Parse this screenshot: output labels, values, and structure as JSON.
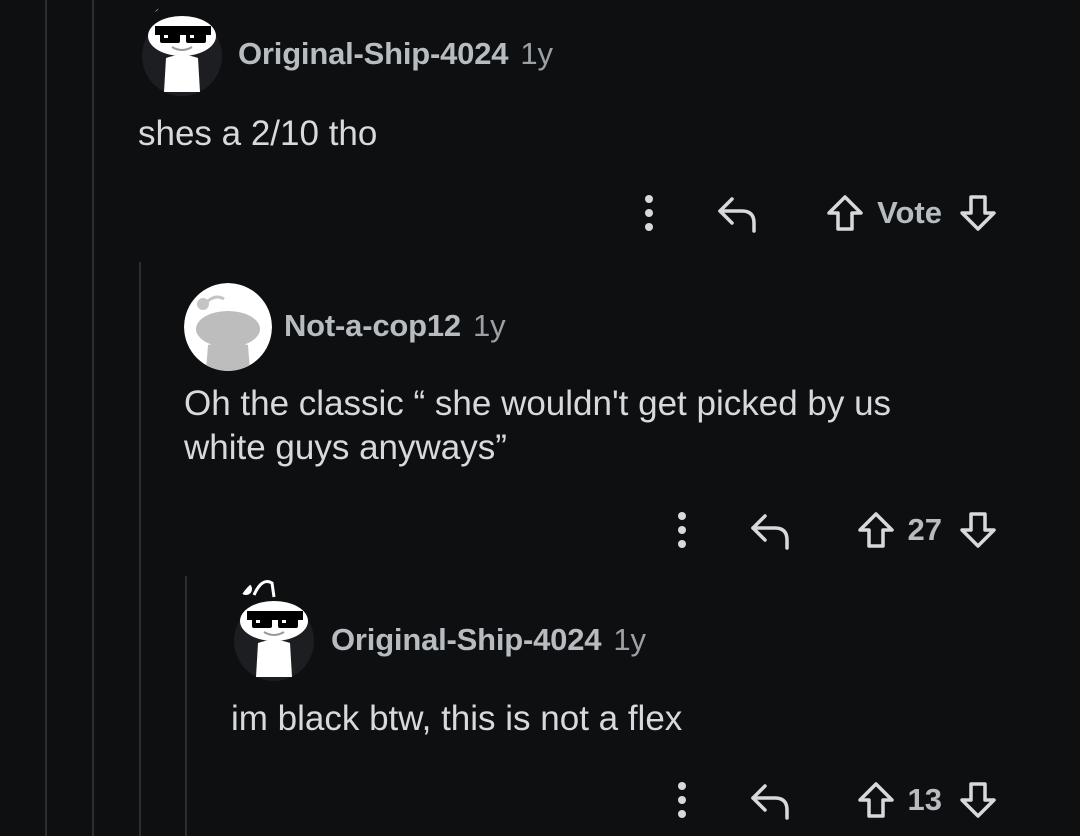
{
  "comments": [
    {
      "username": "Original-Ship-4024",
      "age": "1y",
      "avatar_icon": "snoo-sunglasses-avatar-icon",
      "text": "shes a 2/10 tho",
      "votes": "Vote"
    },
    {
      "username": "Not-a-cop12",
      "age": "1y",
      "avatar_icon": "snoo-default-gray-avatar-icon",
      "text_line1": "Oh the classic “ she wouldn't get picked by us",
      "text_line2": "white guys anyways”",
      "votes": "27"
    },
    {
      "username": "Original-Ship-4024",
      "age": "1y",
      "avatar_icon": "snoo-sunglasses-avatar-icon",
      "text": "im black btw, this is not a flex",
      "votes": "13"
    }
  ],
  "colors": {
    "background": "#0e0f11",
    "text": "#d7dadc",
    "muted": "#b7bcc1",
    "thread_line": "#2b2e32"
  }
}
